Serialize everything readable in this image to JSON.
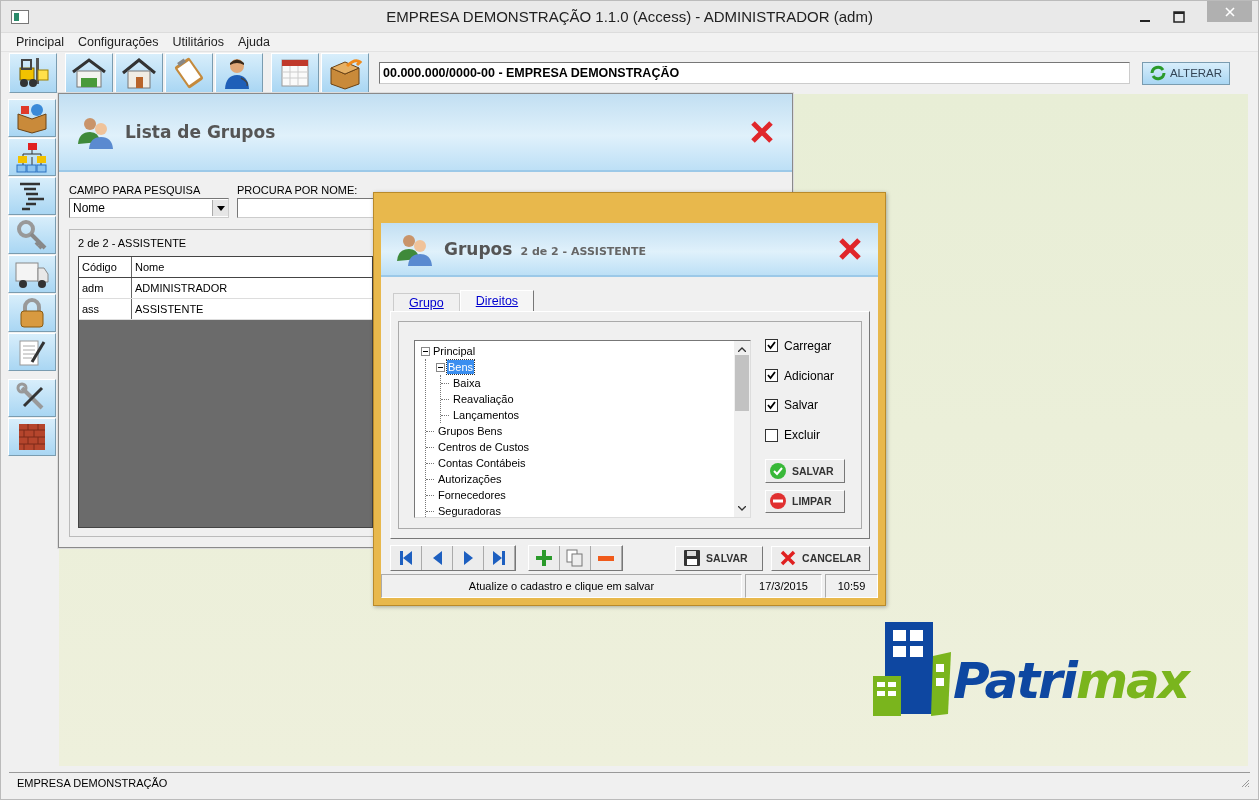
{
  "window": {
    "title": "EMPRESA DEMONSTRAÇÃO 1.1.0 (Access) - ADMINISTRADOR (adm)"
  },
  "menu": [
    {
      "label": "Principal"
    },
    {
      "label": "Configurações"
    },
    {
      "label": "Utilitários"
    },
    {
      "label": "Ajuda"
    }
  ],
  "toolbar": {
    "company": "00.000.000/0000-00 - EMPRESA DEMONSTRAÇÃO",
    "button": "ALTERAR"
  },
  "list_window": {
    "title": "Lista de Grupos",
    "search_field_label": "CAMPO PARA PESQUISA",
    "search_field_value": "Nome",
    "name_search_label": "PROCURA POR NOME:",
    "record_info": "2 de 2 - ASSISTENTE",
    "table": {
      "columns": [
        "Código",
        "Nome"
      ],
      "rows": [
        [
          "adm",
          "ADMINISTRADOR"
        ],
        [
          "ass",
          "ASSISTENTE"
        ]
      ]
    }
  },
  "dialog": {
    "title": "Grupos",
    "subtitle": "2 de 2 - ASSISTENTE",
    "tabs": [
      {
        "label": "Grupo",
        "selected": false
      },
      {
        "label": "Direitos",
        "selected": true
      }
    ],
    "tree": [
      {
        "label": "Principal",
        "selected": false,
        "expanded": true,
        "children": [
          {
            "label": "Bens",
            "selected": true,
            "expanded": true,
            "children": [
              {
                "label": "Baixa",
                "selected": false
              },
              {
                "label": "Reavaliação",
                "selected": false
              },
              {
                "label": "Lançamentos",
                "selected": false
              }
            ]
          },
          {
            "label": "Grupos Bens",
            "selected": false
          },
          {
            "label": "Centros de Custos",
            "selected": false
          },
          {
            "label": "Contas Contábeis",
            "selected": false
          },
          {
            "label": "Autorizações",
            "selected": false
          },
          {
            "label": "Fornecedores",
            "selected": false
          },
          {
            "label": "Seguradoras",
            "selected": false
          }
        ]
      }
    ],
    "permissions": [
      {
        "label": "Carregar",
        "checked": true
      },
      {
        "label": "Adicionar",
        "checked": true
      },
      {
        "label": "Salvar",
        "checked": true
      },
      {
        "label": "Excluir",
        "checked": false
      }
    ],
    "side_buttons": [
      {
        "label": "SALVAR",
        "kind": "save"
      },
      {
        "label": "LIMPAR",
        "kind": "clear"
      }
    ],
    "action_buttons": [
      {
        "label": "SALVAR",
        "kind": "save"
      },
      {
        "label": "CANCELAR",
        "kind": "cancel"
      }
    ],
    "status": {
      "message": "Atualize o cadastro e clique em salvar",
      "date": "17/3/2015",
      "time": "10:59"
    }
  },
  "logo": {
    "parts": [
      {
        "text": "Patri",
        "color": "#0e47a1"
      },
      {
        "text": "max",
        "color": "#7ab51d"
      }
    ]
  },
  "status_bar": {
    "text": "EMPRESA DEMONSTRAÇÃO"
  }
}
